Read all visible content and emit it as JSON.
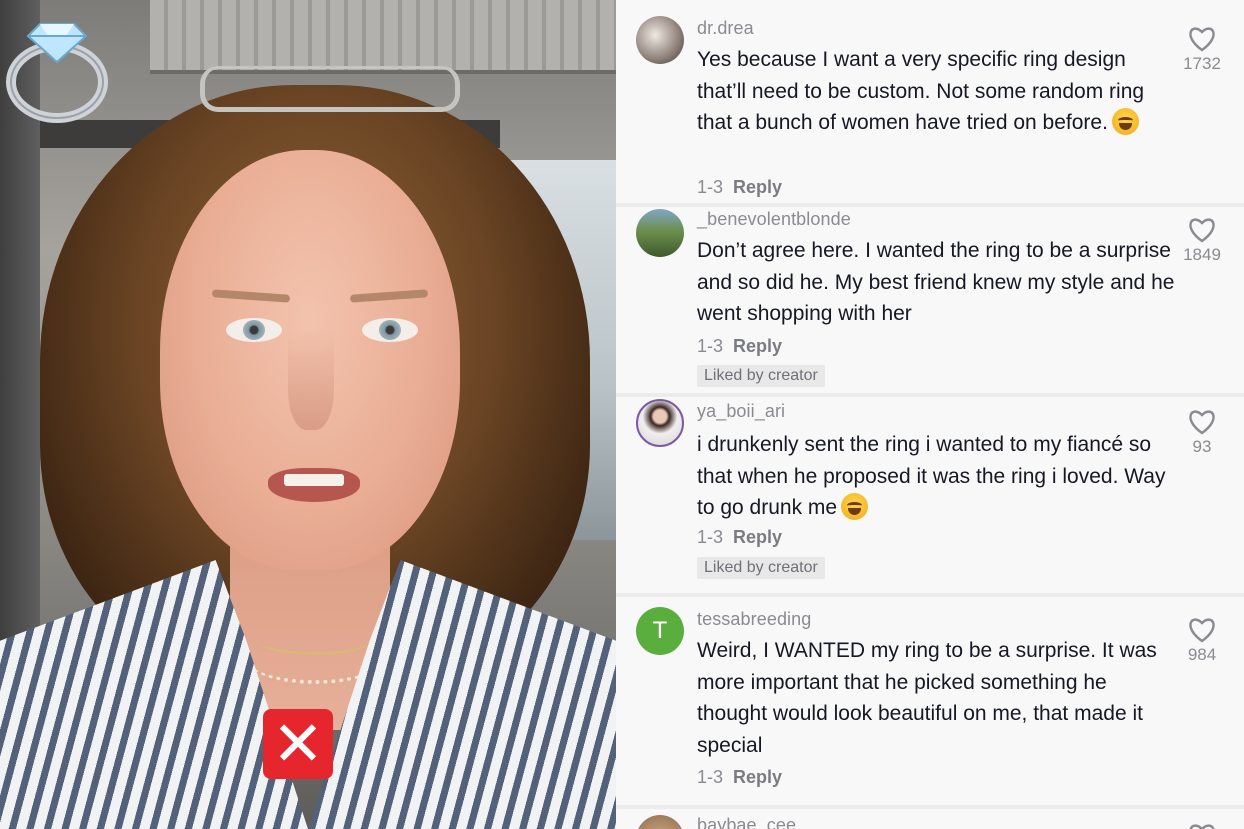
{
  "video": {
    "icons": {
      "ring": "diamond-ring-icon",
      "x": "red-cross-mark-icon"
    },
    "x_mark_symbol": "✕"
  },
  "comments": [
    {
      "username": "dr.drea",
      "text": "Yes because I want a very specific ring design that’ll need to be custom. Not some random ring that a bunch of women have tried on before.",
      "emoji": "sweat-smile-emoji",
      "date": "1-3",
      "reply_label": "Reply",
      "likes": "1732",
      "liked_by_creator": false
    },
    {
      "username": "_benevolentblonde",
      "text": "Don’t agree here. I wanted the ring to be a surprise and so did he. My best friend knew my style and he went shopping with her",
      "date": "1-3",
      "reply_label": "Reply",
      "likes": "1849",
      "liked_by_creator": true,
      "badge": "Liked by creator"
    },
    {
      "username": "ya_boii_ari",
      "text": "i drunkenly sent the ring i wanted to my fiancé so that when he proposed it was the ring i loved. Way to go drunk me",
      "emoji": "tears-of-joy-emoji",
      "date": "1-3",
      "reply_label": "Reply",
      "likes": "93",
      "liked_by_creator": true,
      "badge": "Liked by creator"
    },
    {
      "username": "tessabreeding",
      "avatar_letter": "T",
      "text": "Weird, I WANTED my ring to be a surprise. It was more important that he picked something he thought would look beautiful on me, that made it special",
      "date": "1-3",
      "reply_label": "Reply",
      "likes": "984",
      "liked_by_creator": false
    },
    {
      "username": "baybae_cee"
    }
  ],
  "colors": {
    "accent_green": "#5aae3e",
    "x_red": "#e5262d",
    "text_dark": "#161823",
    "text_muted": "#8a8b91"
  }
}
